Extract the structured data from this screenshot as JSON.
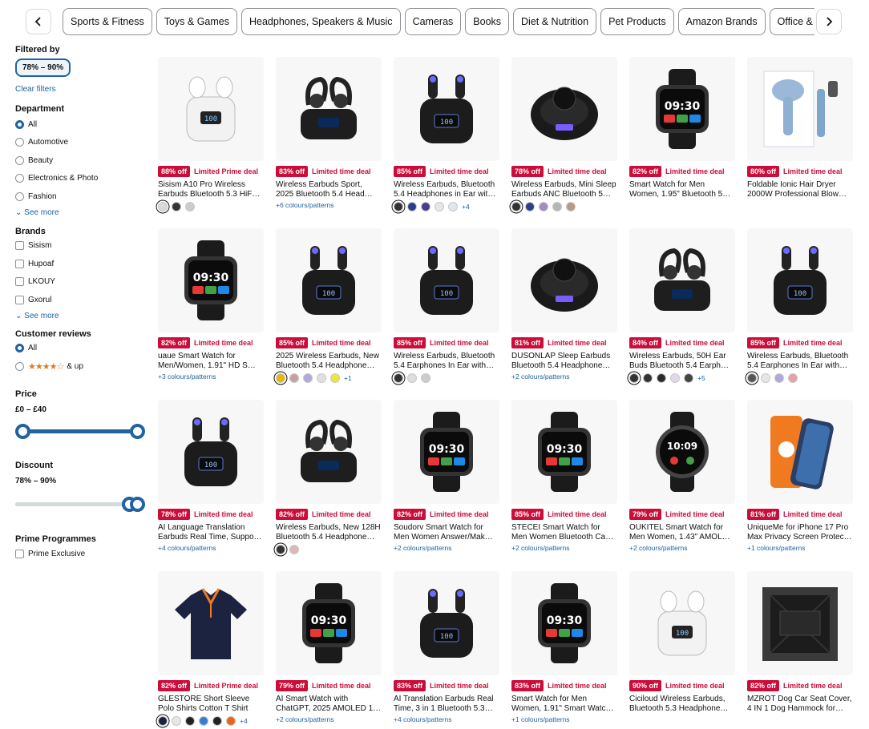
{
  "category_bar": {
    "items": [
      "Sports & Fitness",
      "Toys & Games",
      "Headphones, Speakers & Music",
      "Cameras",
      "Books",
      "Diet & Nutrition",
      "Pet Products",
      "Amazon Brands",
      "Office & School Supplie"
    ]
  },
  "sidebar": {
    "filtered_by_heading": "Filtered by",
    "active_filter": "78% – 90%",
    "clear_filters": "Clear filters",
    "department": {
      "heading": "Department",
      "options": [
        "All",
        "Automotive",
        "Beauty",
        "Electronics & Photo",
        "Fashion"
      ],
      "selected": "All",
      "see_more": "See more"
    },
    "brands": {
      "heading": "Brands",
      "options": [
        "Sisism",
        "Hupoaf",
        "LKOUY",
        "Gxorul"
      ],
      "see_more": "See more"
    },
    "reviews": {
      "heading": "Customer reviews",
      "all_label": "All",
      "stars_label": "★★★★☆",
      "stars_suffix": "& up"
    },
    "price": {
      "heading": "Price",
      "range": "£0 – £40",
      "slider_low": 0.0,
      "slider_high": 1.0
    },
    "discount": {
      "heading": "Discount",
      "range": "78% – 90%",
      "slider_low": 0.93,
      "slider_high": 1.0
    },
    "prime": {
      "heading": "Prime Programmes",
      "options": [
        "Prime Exclusive"
      ]
    }
  },
  "products": [
    {
      "badge": "88% off",
      "deal": "Limited Prime deal",
      "title": "Sisism A10 Pro Wireless Earbuds Bluetooth 5.3 HiF…",
      "colours_text": "",
      "swatches": [
        "#d9d9d9",
        "#333333",
        "#cccccc"
      ],
      "more": "",
      "icon": "earbuds-white-icon"
    },
    {
      "badge": "83% off",
      "deal": "Limited time deal",
      "title": "Wireless Earbuds Sport, 2025 Bluetooth 5.4 Head…",
      "colours_text": "+6 colours/patterns",
      "swatches": [],
      "more": "",
      "icon": "earbuds-sport-icon"
    },
    {
      "badge": "85% off",
      "deal": "Limited time deal",
      "title": "Wireless Earbuds, Bluetooth 5.4 Headphones in Ear wit…",
      "colours_text": "",
      "swatches": [
        "#333333",
        "#2b3f8c",
        "#4b3c8a",
        "#e6e6e6",
        "#dce7f0"
      ],
      "more": "+4",
      "icon": "earbuds-case-icon"
    },
    {
      "badge": "78% off",
      "deal": "Limited time deal",
      "title": "Wireless Earbuds, Mini Sleep Earbuds ANC Bluetooth 5…",
      "colours_text": "",
      "swatches": [
        "#333333",
        "#2b3f8c",
        "#a48bbf",
        "#b5b5b5",
        "#b79a86"
      ],
      "more": "",
      "icon": "earbud-single-icon"
    },
    {
      "badge": "82% off",
      "deal": "Limited time deal",
      "title": "Smart Watch for Men Women, 1.95\" Bluetooth 5…",
      "colours_text": "",
      "swatches": [],
      "more": "",
      "icon": "smartwatch-icon"
    },
    {
      "badge": "80% off",
      "deal": "Limited time deal",
      "title": "Foldable Ionic Hair Dryer 2000W Professional Blow…",
      "colours_text": "",
      "swatches": [],
      "more": "",
      "icon": "hair-dryer-icon"
    },
    {
      "badge": "82% off",
      "deal": "Limited time deal",
      "title": "uaue Smart Watch for Men/Women, 1.91\" HD S…",
      "colours_text": "+3 colours/patterns",
      "swatches": [],
      "more": "",
      "icon": "smartwatch-icon"
    },
    {
      "badge": "85% off",
      "deal": "Limited time deal",
      "title": "2025 Wireless Earbuds, New Bluetooth 5.4 Headphone…",
      "colours_text": "",
      "swatches": [
        "#e8b800",
        "#c9a0a0",
        "#b0a8d8",
        "#e0e0e0",
        "#e8e840"
      ],
      "more": "+1",
      "icon": "earbuds-case-icon"
    },
    {
      "badge": "85% off",
      "deal": "Limited time deal",
      "title": "Wireless Earbuds, Bluetooth 5.4 Earphones In Ear with…",
      "colours_text": "",
      "swatches": [
        "#333333",
        "#dddddd",
        "#cccccc"
      ],
      "more": "",
      "icon": "earbuds-case-icon"
    },
    {
      "badge": "81% off",
      "deal": "Limited time deal",
      "title": "DUSONLAP Sleep Earbuds Bluetooth 5.4 Headphone…",
      "colours_text": "+2 colours/patterns",
      "swatches": [],
      "more": "",
      "icon": "earbud-single-icon"
    },
    {
      "badge": "84% off",
      "deal": "Limited time deal",
      "title": "Wireless Earbuds, 50H Ear Buds Bluetooth 5.4 Earph…",
      "colours_text": "",
      "swatches": [
        "#333333",
        "#333333",
        "#2b2b2b",
        "#e0d8e8",
        "#444444"
      ],
      "more": "+5",
      "icon": "earbuds-sport-icon"
    },
    {
      "badge": "85% off",
      "deal": "Limited time deal",
      "title": "Wireless Earbuds, Bluetooth 5.4 Earphones In Ear with…",
      "colours_text": "",
      "swatches": [
        "#555555",
        "#e6e6e6",
        "#b0a8d8",
        "#e8a0a8"
      ],
      "more": "",
      "icon": "earbuds-case-icon"
    },
    {
      "badge": "78% off",
      "deal": "Limited time deal",
      "title": "AI Language Translation Earbuds Real Time, Suppo…",
      "colours_text": "+4 colours/patterns",
      "swatches": [],
      "more": "",
      "icon": "earbuds-case-icon"
    },
    {
      "badge": "82% off",
      "deal": "Limited time deal",
      "title": "Wireless Earbuds, New 128H Bluetooth 5.4 Headphone…",
      "colours_text": "",
      "swatches": [
        "#333333",
        "#d9b8b8"
      ],
      "more": "",
      "icon": "earbuds-sport-icon"
    },
    {
      "badge": "82% off",
      "deal": "Limited time deal",
      "title": "Soudorv Smart Watch for Men Women Answer/Mak…",
      "colours_text": "+2 colours/patterns",
      "swatches": [],
      "more": "",
      "icon": "smartwatch-icon"
    },
    {
      "badge": "85% off",
      "deal": "Limited time deal",
      "title": "STECEI Smart Watch for Men Women Bluetooth Ca…",
      "colours_text": "+2 colours/patterns",
      "swatches": [],
      "more": "",
      "icon": "smartwatch-icon"
    },
    {
      "badge": "79% off",
      "deal": "Limited time deal",
      "title": "OUKITEL Smart Watch for Men Women, 1.43\" AMOL…",
      "colours_text": "+2 colours/patterns",
      "swatches": [],
      "more": "",
      "icon": "smartwatch-round-icon"
    },
    {
      "badge": "81% off",
      "deal": "Limited time deal",
      "title": "UniqueMe for iPhone 17 Pro Max Privacy Screen Protec…",
      "colours_text": "+1 colours/patterns",
      "swatches": [],
      "more": "",
      "icon": "screen-protector-icon"
    },
    {
      "badge": "82% off",
      "deal": "Limited Prime deal",
      "title": "GLESTORE Short Sleeve Polo Shirts Cotton T Shirt",
      "colours_text": "",
      "swatches": [
        "#1b2340",
        "#e6e6e6",
        "#222222",
        "#3a7bd5",
        "#222222",
        "#e8641e"
      ],
      "more": "+4",
      "icon": "polo-shirt-icon"
    },
    {
      "badge": "79% off",
      "deal": "Limited time deal",
      "title": "AI Smart Watch with ChatGPT, 2025 AMOLED 1…",
      "colours_text": "+2 colours/patterns",
      "swatches": [],
      "more": "",
      "icon": "smartwatch-icon"
    },
    {
      "badge": "83% off",
      "deal": "Limited time deal",
      "title": "AI Translation Earbuds Real Time, 3 in 1 Bluetooth 5.3…",
      "colours_text": "+4 colours/patterns",
      "swatches": [],
      "more": "",
      "icon": "earbuds-case-icon"
    },
    {
      "badge": "83% off",
      "deal": "Limited time deal",
      "title": "Smart Watch for Men Women, 1.91\" Smart Watc…",
      "colours_text": "+1 colours/patterns",
      "swatches": [],
      "more": "",
      "icon": "smartwatch-icon"
    },
    {
      "badge": "90% off",
      "deal": "Limited time deal",
      "title": "Ciciloud Wireless Earbuds, Bluetooth 5.3 Headphone…",
      "colours_text": "",
      "swatches": [],
      "more": "",
      "icon": "earbuds-white-icon"
    },
    {
      "badge": "82% off",
      "deal": "Limited time deal",
      "title": "MZROT Dog Car Seat Cover, 4 IN 1 Dog Hammock for…",
      "colours_text": "",
      "swatches": [],
      "more": "",
      "icon": "car-seat-cover-icon"
    }
  ]
}
